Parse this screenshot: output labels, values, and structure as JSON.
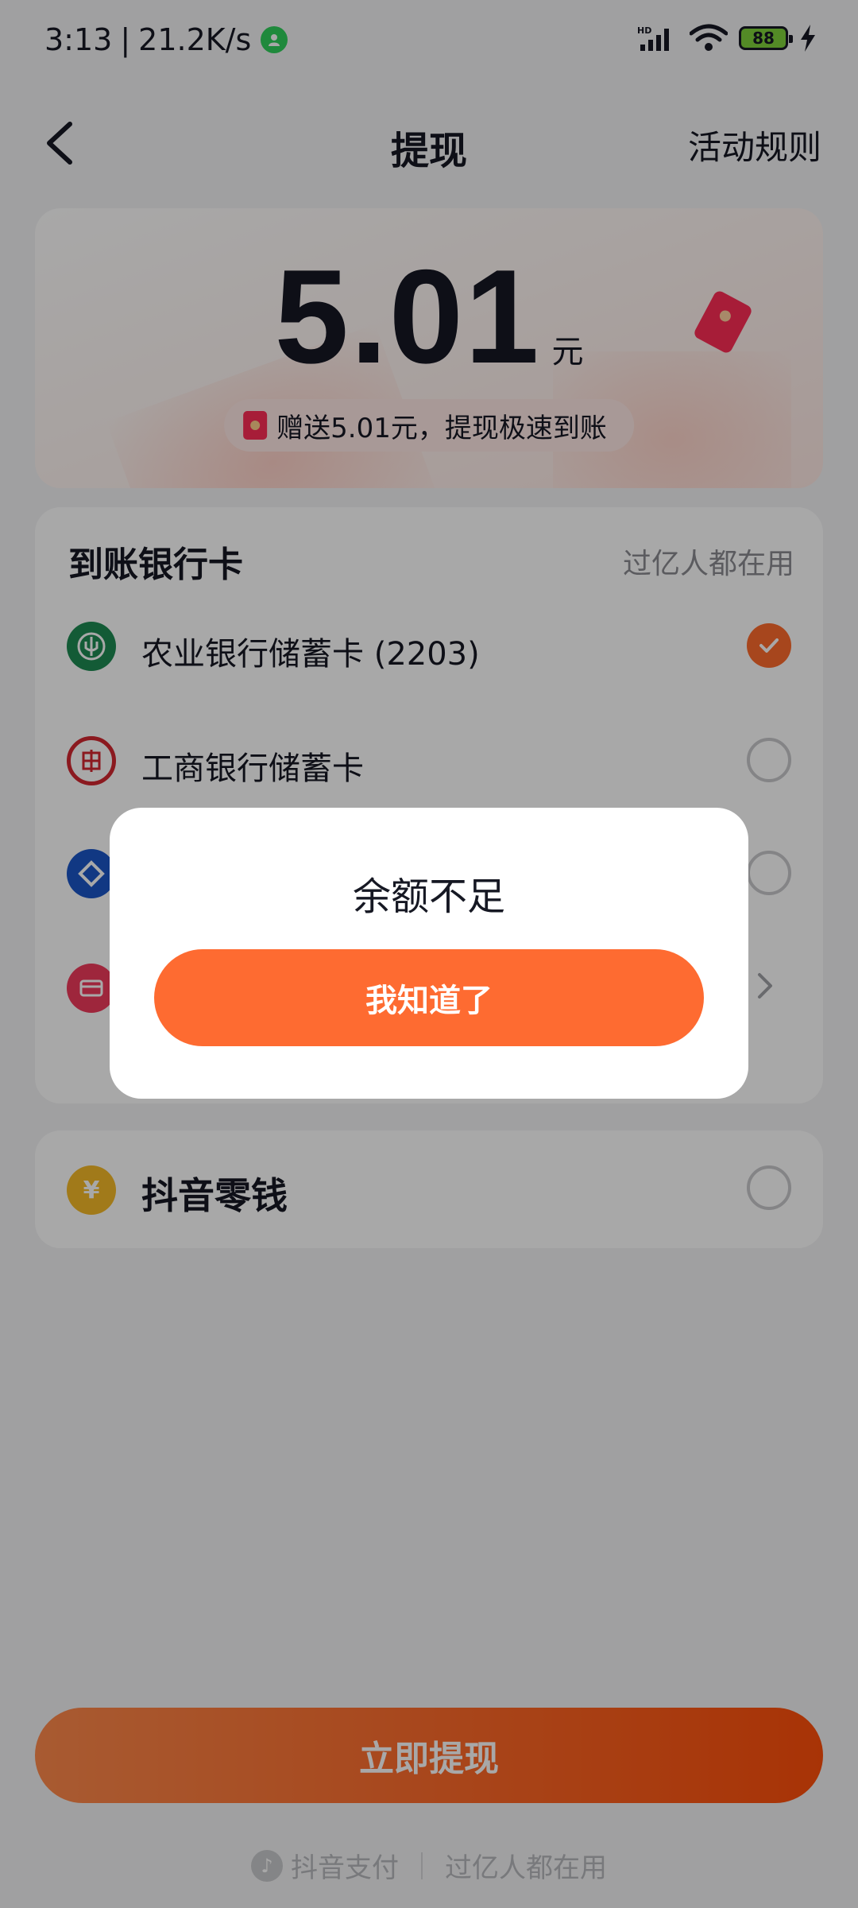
{
  "status_bar": {
    "time": "3:13",
    "network_speed": "21.2K/s",
    "battery_level": "88",
    "icons": [
      "hd-signal-icon",
      "wifi-icon",
      "battery-icon",
      "charging-icon"
    ]
  },
  "nav": {
    "title": "提现",
    "rules_label": "活动规则"
  },
  "amount": {
    "value": "5.01",
    "unit": "元",
    "bonus_text": "赠送5.01元，提现极速到账"
  },
  "bank_section": {
    "title": "到账银行卡",
    "tagline": "过亿人都在用",
    "items": [
      {
        "name": "农业银行储蓄卡 (2203)",
        "logo": "abc-bank-icon",
        "color": "#1d8a52",
        "selected": true
      },
      {
        "name": "工商银行储蓄卡",
        "logo": "icbc-bank-icon",
        "color": "#d3272f",
        "selected": false
      },
      {
        "name": "",
        "logo": "ccb-bank-icon",
        "color": "#1b56c7",
        "selected": false
      },
      {
        "name": "",
        "logo": "card-icon",
        "color": "#f03a5c",
        "selected": false
      }
    ]
  },
  "douyin_change": {
    "label": "抖音零钱",
    "logo_glyph": "¥"
  },
  "withdraw_button": {
    "label": "立即提现"
  },
  "footer": {
    "brand": "抖音支付",
    "tagline": "过亿人都在用"
  },
  "modal": {
    "title": "余额不足",
    "confirm_label": "我知道了"
  },
  "colors": {
    "accent": "#fe6b31",
    "brand_red": "#fe2c55"
  }
}
